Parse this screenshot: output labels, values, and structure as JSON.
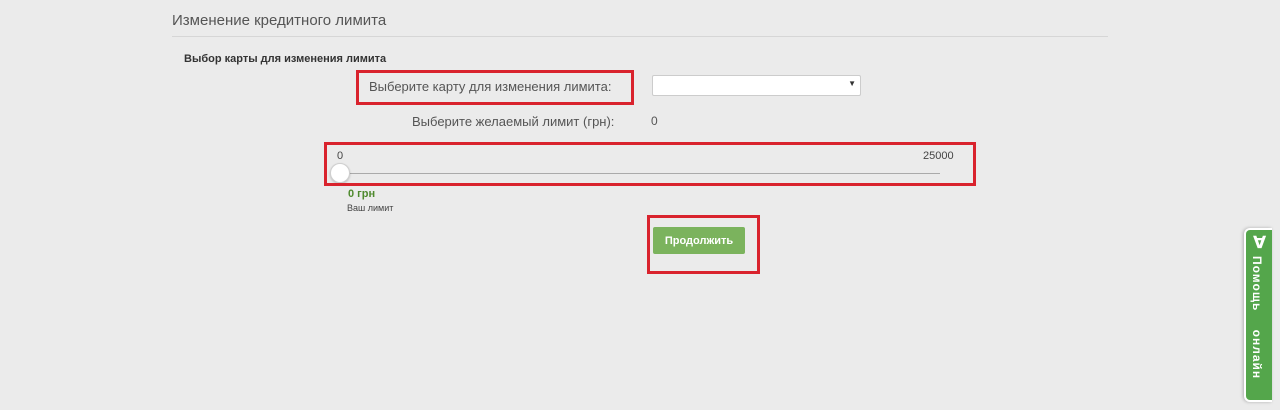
{
  "page": {
    "title": "Изменение кредитного лимита"
  },
  "form": {
    "section_title": "Выбор карты для изменения лимита",
    "card_label": "Выберите карту для изменения лимита:",
    "card_select_value": "",
    "limit_label": "Выберите желаемый лимит (грн):",
    "limit_value": "0"
  },
  "slider": {
    "min_label": "0",
    "max_label": "25000",
    "min": 0,
    "max": 25000,
    "value": 0,
    "value_display": "0 грн",
    "value_caption": "Ваш лимит"
  },
  "actions": {
    "continue_label": "Продолжить"
  },
  "help": {
    "label": "Помощь онлайн",
    "icon": "help-chat-icon"
  },
  "colors": {
    "accent_green": "#7bb35d",
    "help_tab_green": "#54a64b",
    "highlight_red": "#d9232d",
    "limit_text_green": "#4f8a2e"
  }
}
